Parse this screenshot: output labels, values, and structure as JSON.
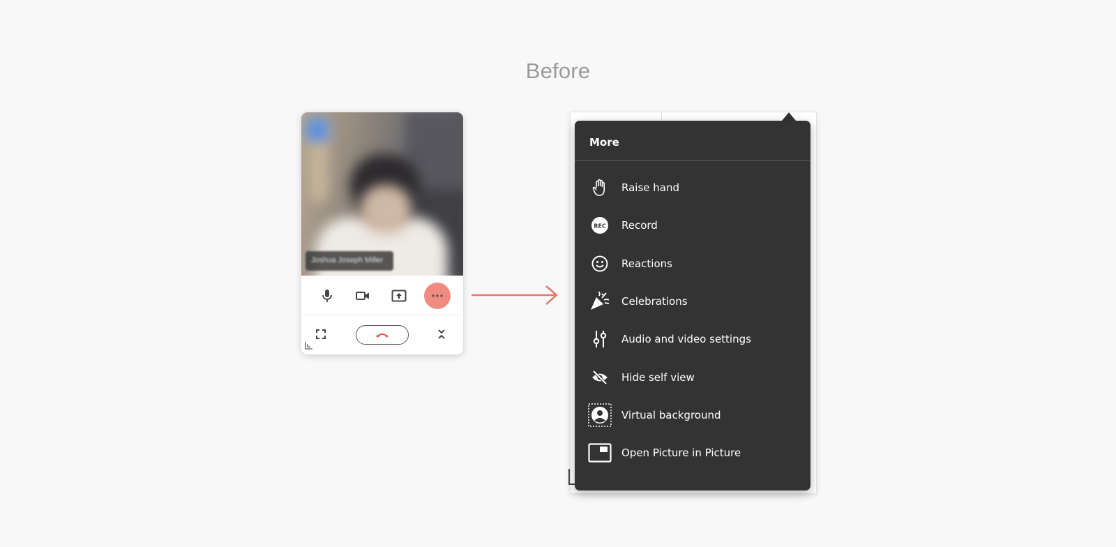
{
  "heading": "Before",
  "mini_window": {
    "participant_name": "Joshua Joseph Miller"
  },
  "menu": {
    "title": "More",
    "items": [
      {
        "label": "Raise hand",
        "icon": "raise-hand-icon"
      },
      {
        "label": "Record",
        "icon": "record-icon"
      },
      {
        "label": "Reactions",
        "icon": "reactions-icon"
      },
      {
        "label": "Celebrations",
        "icon": "celebrations-icon"
      },
      {
        "label": "Audio and video settings",
        "icon": "settings-sliders-icon"
      },
      {
        "label": "Hide self view",
        "icon": "eye-off-icon"
      },
      {
        "label": "Virtual background",
        "icon": "virtual-background-icon"
      },
      {
        "label": "Open Picture in Picture",
        "icon": "picture-in-picture-icon"
      }
    ]
  },
  "colors": {
    "accent": "#ef8b80",
    "menu_bg": "#333333",
    "hangup_red": "#e4564b"
  }
}
